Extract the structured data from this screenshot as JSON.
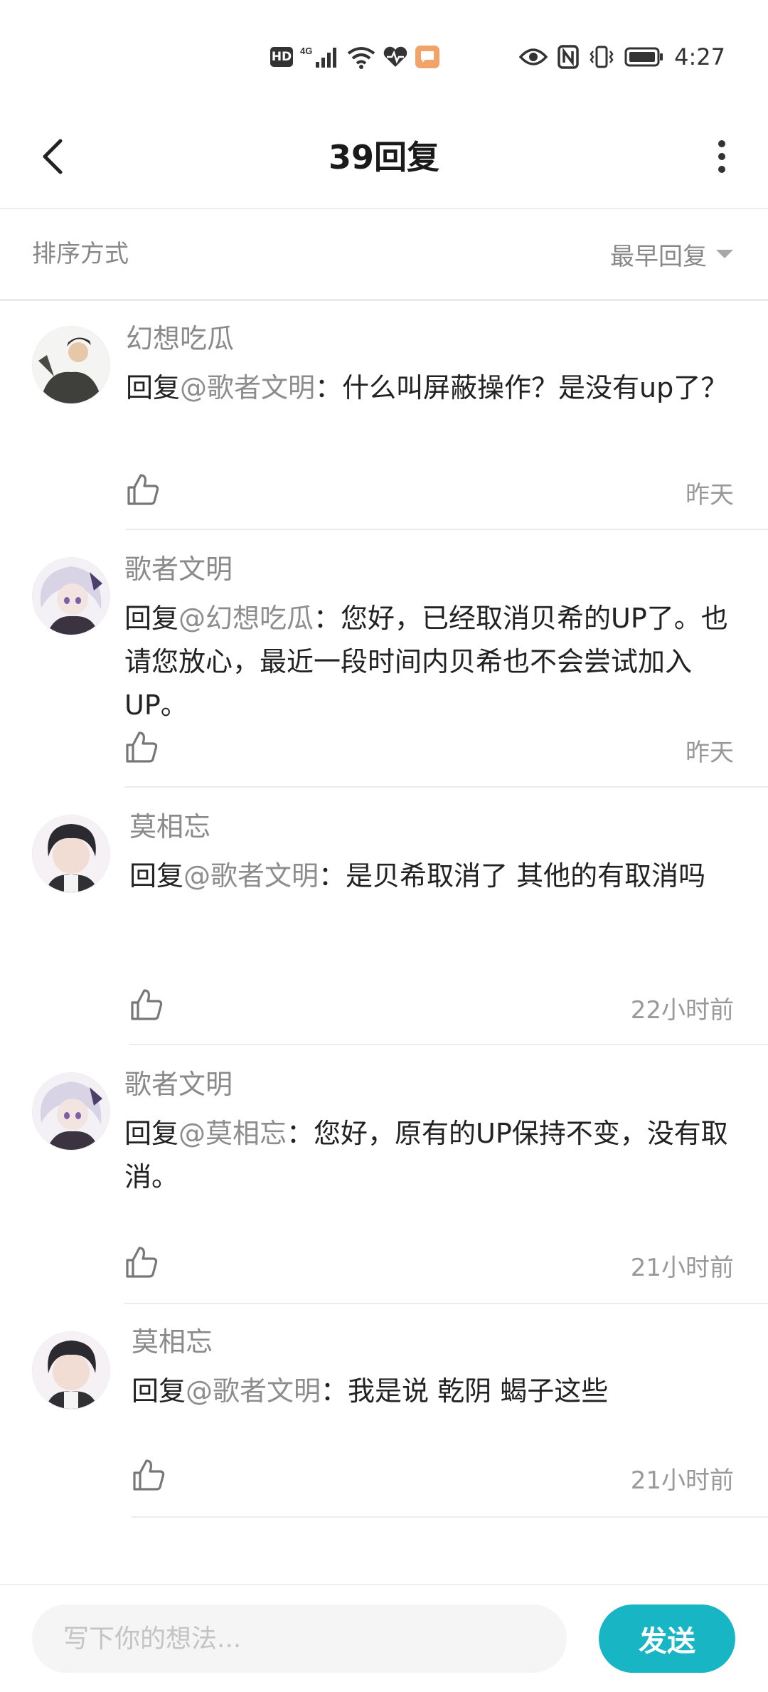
{
  "status_bar": {
    "hd_badge": "HD",
    "network": "4G",
    "time": "4:27"
  },
  "header": {
    "title": "39回复"
  },
  "sort": {
    "label": "排序方式",
    "selected": "最早回复"
  },
  "comments": [
    {
      "author": "幻想吃瓜",
      "reply_prefix": "回复",
      "mention": "@歌者文明",
      "text": "：什么叫屏蔽操作？是没有up了？",
      "time": "昨天"
    },
    {
      "author": "歌者文明",
      "reply_prefix": "回复",
      "mention": "@幻想吃瓜",
      "text": "：您好，已经取消贝希的UP了。也请您放心，最近一段时间内贝希也不会尝试加入UP。",
      "time": "昨天"
    },
    {
      "author": "莫相忘",
      "reply_prefix": "回复",
      "mention": "@歌者文明",
      "text": "：是贝希取消了 其他的有取消吗",
      "time": "22小时前"
    },
    {
      "author": "歌者文明",
      "reply_prefix": "回复",
      "mention": "@莫相忘",
      "text": "：您好，原有的UP保持不变，没有取消。",
      "time": "21小时前"
    },
    {
      "author": "莫相忘",
      "reply_prefix": "回复",
      "mention": "@歌者文明",
      "text": "：我是说 乾阴 蝎子这些",
      "time": "21小时前"
    }
  ],
  "composer": {
    "placeholder": "写下你的想法...",
    "value": "",
    "send_label": "发送"
  },
  "colors": {
    "accent": "#18b6c4",
    "mention": "#8d8d8d",
    "secondary_text": "#888888"
  },
  "icons": [
    "back-arrow-icon",
    "more-vertical-icon",
    "dropdown-triangle-icon",
    "thumbs-up-icon",
    "eye-icon",
    "nfc-icon",
    "vibrate-icon",
    "battery-icon",
    "wifi-icon",
    "signal-icon",
    "health-heart-icon",
    "message-icon"
  ]
}
